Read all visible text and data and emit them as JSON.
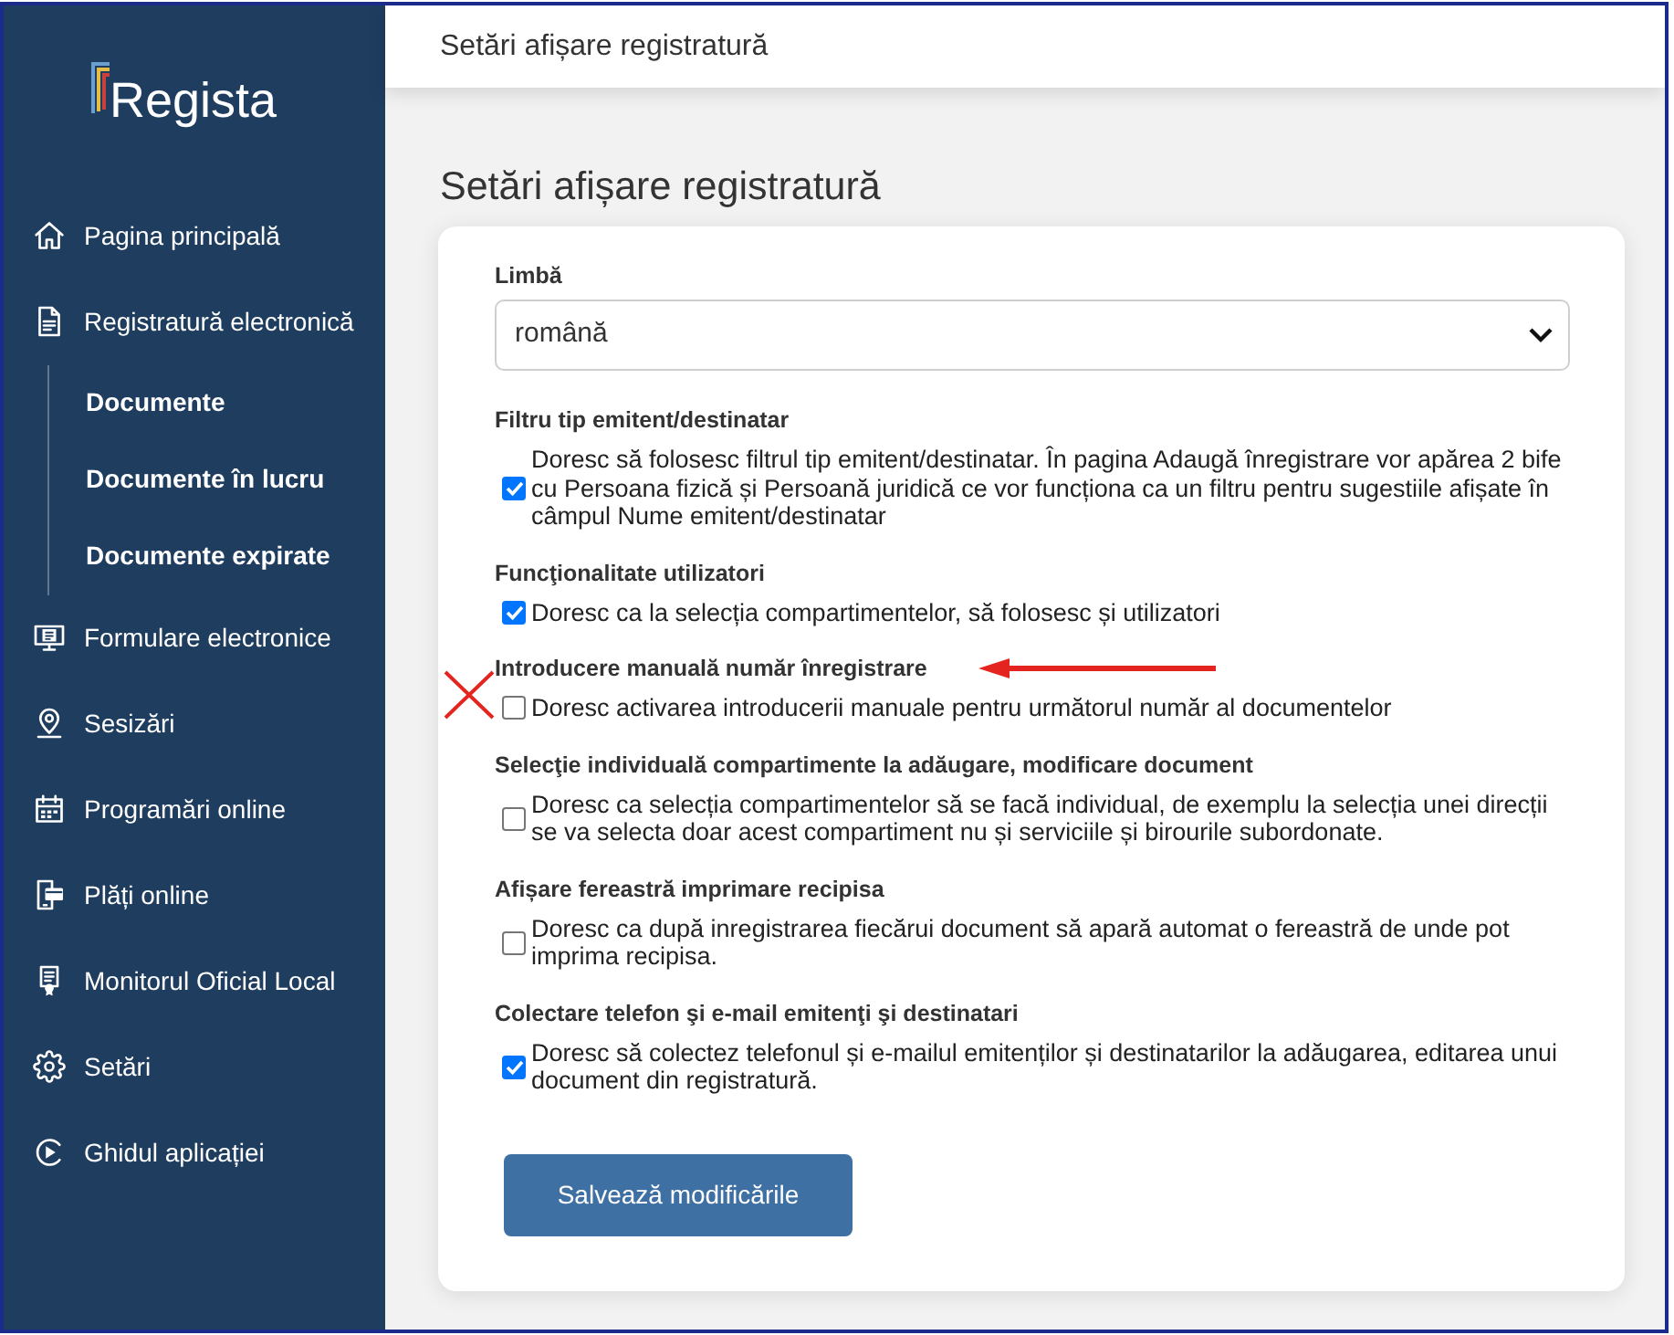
{
  "sidebar": {
    "logo": "Regista",
    "items": [
      {
        "label": "Pagina principală"
      },
      {
        "label": "Registratură electronică",
        "children": [
          {
            "label": "Documente"
          },
          {
            "label": "Documente în lucru"
          },
          {
            "label": "Documente expirate"
          }
        ]
      },
      {
        "label": "Formulare electronice"
      },
      {
        "label": "Sesizări"
      },
      {
        "label": "Programări online"
      },
      {
        "label": "Plăți online"
      },
      {
        "label": "Monitorul Oficial Local"
      },
      {
        "label": "Setări"
      },
      {
        "label": "Ghidul aplicației"
      }
    ]
  },
  "header": {
    "title": "Setări afișare registratură"
  },
  "page": {
    "title": "Setări afișare registratură",
    "form": {
      "language": {
        "label": "Limbă",
        "value": "română"
      },
      "sections": [
        {
          "heading": "Filtru tip emitent/destinatar",
          "option": {
            "text": "Doresc să folosesc filtrul tip emitent/destinatar. În pagina Adaugă înregistrare vor apărea 2 bife cu Persoana fizică și Persoană juridică ce vor funcționa ca un filtru pentru sugestiile afișate în câmpul Nume emitent/destinatar",
            "checked": true
          }
        },
        {
          "heading": "Funcţionalitate utilizatori",
          "option": {
            "text": "Doresc ca la selecția compartimentelor, să folosesc și utilizatori",
            "checked": true
          }
        },
        {
          "heading": "Introducere manuală număr înregistrare",
          "option": {
            "text": "Doresc activarea introducerii manuale pentru următorul număr al documentelor",
            "checked": false
          },
          "arrow_mark": true,
          "cross_mark": true
        },
        {
          "heading": "Selecţie individuală compartimente la adăugare, modificare document",
          "option": {
            "text": "Doresc ca selecția compartimentelor să se facă individual, de exemplu la selecția unei direcții se va selecta doar acest compartiment nu și serviciile și birourile subordonate.",
            "checked": false
          }
        },
        {
          "heading": "Afișare fereastră imprimare recipisa",
          "option": {
            "text": "Doresc ca după inregistrarea fiecărui document să apară automat o fereastră de unde pot imprima recipisa.",
            "checked": false
          }
        },
        {
          "heading": "Colectare telefon şi e-mail emitenţi şi destinatari",
          "option": {
            "text": "Doresc să colectez telefonul și e-mailul emitenților și destinatarilor la adăugarea, editarea unui document din registratură.",
            "checked": true
          }
        }
      ],
      "save_button": "Salvează modificările"
    }
  }
}
